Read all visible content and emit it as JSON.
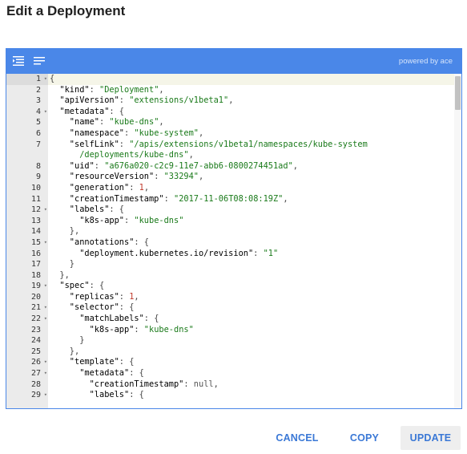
{
  "dialog": {
    "title": "Edit a Deployment"
  },
  "editor": {
    "powered_by": "powered by ace",
    "toolbar_icons": [
      "format-icon",
      "compact-icon"
    ],
    "active_line": 1,
    "fold_lines": [
      1,
      4,
      12,
      15,
      19,
      21,
      22,
      26,
      27,
      29
    ],
    "line_numbers": [
      "1",
      "2",
      "3",
      "4",
      "5",
      "6",
      "7",
      "",
      "8",
      "9",
      "10",
      "11",
      "12",
      "13",
      "14",
      "15",
      "16",
      "17",
      "18",
      "19",
      "20",
      "21",
      "22",
      "23",
      "24",
      "25",
      "26",
      "27",
      "28",
      "29"
    ],
    "lines": [
      [
        [
          "p",
          "{"
        ]
      ],
      [
        [
          "k",
          "  \"kind\""
        ],
        [
          "p",
          ": "
        ],
        [
          "s",
          "\"Deployment\""
        ],
        [
          "p",
          ","
        ]
      ],
      [
        [
          "k",
          "  \"apiVersion\""
        ],
        [
          "p",
          ": "
        ],
        [
          "s",
          "\"extensions/v1beta1\""
        ],
        [
          "p",
          ","
        ]
      ],
      [
        [
          "k",
          "  \"metadata\""
        ],
        [
          "p",
          ": {"
        ]
      ],
      [
        [
          "k",
          "    \"name\""
        ],
        [
          "p",
          ": "
        ],
        [
          "s",
          "\"kube-dns\""
        ],
        [
          "p",
          ","
        ]
      ],
      [
        [
          "k",
          "    \"namespace\""
        ],
        [
          "p",
          ": "
        ],
        [
          "s",
          "\"kube-system\""
        ],
        [
          "p",
          ","
        ]
      ],
      [
        [
          "k",
          "    \"selfLink\""
        ],
        [
          "p",
          ": "
        ],
        [
          "s",
          "\"/apis/extensions/v1beta1/namespaces/kube-system"
        ]
      ],
      [
        [
          "s",
          "      /deployments/kube-dns\""
        ],
        [
          "p",
          ","
        ]
      ],
      [
        [
          "k",
          "    \"uid\""
        ],
        [
          "p",
          ": "
        ],
        [
          "s",
          "\"a676a020-c2c9-11e7-abb6-0800274451ad\""
        ],
        [
          "p",
          ","
        ]
      ],
      [
        [
          "k",
          "    \"resourceVersion\""
        ],
        [
          "p",
          ": "
        ],
        [
          "s",
          "\"33294\""
        ],
        [
          "p",
          ","
        ]
      ],
      [
        [
          "k",
          "    \"generation\""
        ],
        [
          "p",
          ": "
        ],
        [
          "n",
          "1"
        ],
        [
          "p",
          ","
        ]
      ],
      [
        [
          "k",
          "    \"creationTimestamp\""
        ],
        [
          "p",
          ": "
        ],
        [
          "s",
          "\"2017-11-06T08:08:19Z\""
        ],
        [
          "p",
          ","
        ]
      ],
      [
        [
          "k",
          "    \"labels\""
        ],
        [
          "p",
          ": {"
        ]
      ],
      [
        [
          "k",
          "      \"k8s-app\""
        ],
        [
          "p",
          ": "
        ],
        [
          "s",
          "\"kube-dns\""
        ]
      ],
      [
        [
          "p",
          "    },"
        ]
      ],
      [
        [
          "k",
          "    \"annotations\""
        ],
        [
          "p",
          ": {"
        ]
      ],
      [
        [
          "k",
          "      \"deployment.kubernetes.io/revision\""
        ],
        [
          "p",
          ": "
        ],
        [
          "s",
          "\"1\""
        ]
      ],
      [
        [
          "p",
          "    }"
        ]
      ],
      [
        [
          "p",
          "  },"
        ]
      ],
      [
        [
          "k",
          "  \"spec\""
        ],
        [
          "p",
          ": {"
        ]
      ],
      [
        [
          "k",
          "    \"replicas\""
        ],
        [
          "p",
          ": "
        ],
        [
          "n",
          "1"
        ],
        [
          "p",
          ","
        ]
      ],
      [
        [
          "k",
          "    \"selector\""
        ],
        [
          "p",
          ": {"
        ]
      ],
      [
        [
          "k",
          "      \"matchLabels\""
        ],
        [
          "p",
          ": {"
        ]
      ],
      [
        [
          "k",
          "        \"k8s-app\""
        ],
        [
          "p",
          ": "
        ],
        [
          "s",
          "\"kube-dns\""
        ]
      ],
      [
        [
          "p",
          "      }"
        ]
      ],
      [
        [
          "p",
          "    },"
        ]
      ],
      [
        [
          "k",
          "    \"template\""
        ],
        [
          "p",
          ": {"
        ]
      ],
      [
        [
          "k",
          "      \"metadata\""
        ],
        [
          "p",
          ": {"
        ]
      ],
      [
        [
          "k",
          "        \"creationTimestamp\""
        ],
        [
          "p",
          ": "
        ],
        [
          "nl",
          "null"
        ],
        [
          "p",
          ","
        ]
      ],
      [
        [
          "k",
          "        \"labels\""
        ],
        [
          "p",
          ": {"
        ]
      ]
    ]
  },
  "buttons": {
    "cancel": "CANCEL",
    "copy": "COPY",
    "update": "UPDATE"
  },
  "colors": {
    "toolbar": "#4a87e8",
    "button_text": "#3a78d6",
    "string": "#1a7a1a",
    "number": "#c0392b"
  }
}
